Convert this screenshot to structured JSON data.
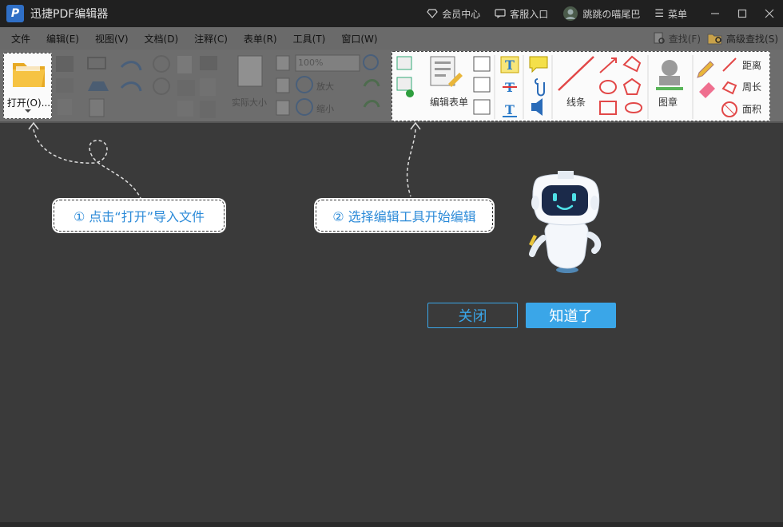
{
  "titlebar": {
    "title": "迅捷PDF编辑器",
    "logo_letter": "P",
    "member_center": "会员中心",
    "customer_service": "客服入口",
    "username": "跳跳の喵尾巴",
    "menu_label": "菜单"
  },
  "menubar": {
    "items": [
      "文件",
      "编辑(E)",
      "视图(V)",
      "文档(D)",
      "注释(C)",
      "表单(R)",
      "工具(T)",
      "窗口(W)"
    ],
    "find": "查找(F)",
    "advanced_find": "高级查找(S)"
  },
  "ribbon": {
    "open_label": "打开(O)...",
    "actual_size": "实际大小",
    "zoom_value": "100%",
    "zoom_in": "放大",
    "zoom_out": "缩小",
    "edit_form": "编辑表单",
    "lines": "线条",
    "stamp": "图章",
    "distance": "距离",
    "perimeter": "周长",
    "area": "面积"
  },
  "guide": {
    "step1": "① 点击“打开”导入文件",
    "step2": "② 选择编辑工具开始编辑",
    "close_button": "关闭",
    "ok_button": "知道了"
  },
  "colors": {
    "accent": "#3aa6e8",
    "callout_text": "#2b8ad8",
    "titlebar_bg": "#202020"
  }
}
